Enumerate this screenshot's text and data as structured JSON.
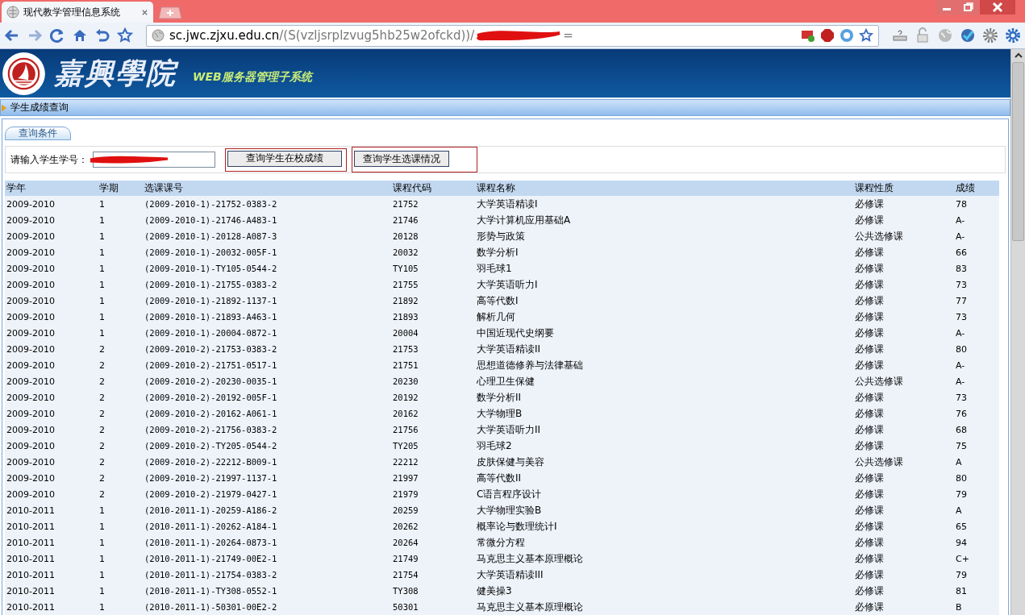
{
  "browser": {
    "tab_title": "现代教学管理信息系统",
    "url_host": "sc.jwc.zjxu.edu.cn",
    "url_path": "/(S(vzljsrplzvug5hb25w2ofckd))/",
    "url_tail": "="
  },
  "header": {
    "logo_text": "嘉興學院",
    "subtitle": "WEB服务器管理子系统"
  },
  "panel": {
    "title": "学生成绩查询",
    "tab": "查询条件"
  },
  "form": {
    "label": "请输入学生学号：",
    "buttons": [
      "查询学生在校成绩",
      "查询学生选课情况"
    ]
  },
  "table": {
    "columns": [
      "学年",
      "学期",
      "选课课号",
      "课程代码",
      "课程名称",
      "课程性质",
      "成绩"
    ],
    "rows": [
      [
        "2009-2010",
        "1",
        "(2009-2010-1)-21752-0383-2",
        "21752",
        "大学英语精读I",
        "必修课",
        "78"
      ],
      [
        "2009-2010",
        "1",
        "(2009-2010-1)-21746-A483-1",
        "21746",
        "大学计算机应用基础A",
        "必修课",
        "A-"
      ],
      [
        "2009-2010",
        "1",
        "(2009-2010-1)-20128-A087-3",
        "20128",
        "形势与政策",
        "公共选修课",
        "A-"
      ],
      [
        "2009-2010",
        "1",
        "(2009-2010-1)-20032-005F-1",
        "20032",
        "数学分析I",
        "必修课",
        "66"
      ],
      [
        "2009-2010",
        "1",
        "(2009-2010-1)-TY105-0544-2",
        "TY105",
        "羽毛球1",
        "必修课",
        "83"
      ],
      [
        "2009-2010",
        "1",
        "(2009-2010-1)-21755-0383-2",
        "21755",
        "大学英语听力I",
        "必修课",
        "73"
      ],
      [
        "2009-2010",
        "1",
        "(2009-2010-1)-21892-1137-1",
        "21892",
        "高等代数I",
        "必修课",
        "77"
      ],
      [
        "2009-2010",
        "1",
        "(2009-2010-1)-21893-A463-1",
        "21893",
        "解析几何",
        "必修课",
        "73"
      ],
      [
        "2009-2010",
        "1",
        "(2009-2010-1)-20004-0872-1",
        "20004",
        "中国近现代史纲要",
        "必修课",
        "A-"
      ],
      [
        "2009-2010",
        "2",
        "(2009-2010-2)-21753-0383-2",
        "21753",
        "大学英语精读II",
        "必修课",
        "80"
      ],
      [
        "2009-2010",
        "2",
        "(2009-2010-2)-21751-0517-1",
        "21751",
        "思想道德修养与法律基础",
        "必修课",
        "A-"
      ],
      [
        "2009-2010",
        "2",
        "(2009-2010-2)-20230-0035-1",
        "20230",
        "心理卫生保健",
        "公共选修课",
        "A-"
      ],
      [
        "2009-2010",
        "2",
        "(2009-2010-2)-20192-005F-1",
        "20192",
        "数学分析II",
        "必修课",
        "73"
      ],
      [
        "2009-2010",
        "2",
        "(2009-2010-2)-20162-A061-1",
        "20162",
        "大学物理B",
        "必修课",
        "76"
      ],
      [
        "2009-2010",
        "2",
        "(2009-2010-2)-21756-0383-2",
        "21756",
        "大学英语听力II",
        "必修课",
        "68"
      ],
      [
        "2009-2010",
        "2",
        "(2009-2010-2)-TY205-0544-2",
        "TY205",
        "羽毛球2",
        "必修课",
        "75"
      ],
      [
        "2009-2010",
        "2",
        "(2009-2010-2)-22212-B009-1",
        "22212",
        "皮肤保健与美容",
        "公共选修课",
        "A"
      ],
      [
        "2009-2010",
        "2",
        "(2009-2010-2)-21997-1137-1",
        "21997",
        "高等代数II",
        "必修课",
        "80"
      ],
      [
        "2009-2010",
        "2",
        "(2009-2010-2)-21979-0427-1",
        "21979",
        "C语言程序设计",
        "必修课",
        "79"
      ],
      [
        "2010-2011",
        "1",
        "(2010-2011-1)-20259-A186-2",
        "20259",
        "大学物理实验B",
        "必修课",
        "A"
      ],
      [
        "2010-2011",
        "1",
        "(2010-2011-1)-20262-A184-1",
        "20262",
        "概率论与数理统计I",
        "必修课",
        "65"
      ],
      [
        "2010-2011",
        "1",
        "(2010-2011-1)-20264-0873-1",
        "20264",
        "常微分方程",
        "必修课",
        "94"
      ],
      [
        "2010-2011",
        "1",
        "(2010-2011-1)-21749-00E2-1",
        "21749",
        "马克思主义基本原理概论",
        "必修课",
        "C+"
      ],
      [
        "2010-2011",
        "1",
        "(2010-2011-1)-21754-0383-2",
        "21754",
        "大学英语精读III",
        "必修课",
        "79"
      ],
      [
        "2010-2011",
        "1",
        "(2010-2011-1)-TY308-0552-1",
        "TY308",
        "健美操3",
        "必修课",
        "81"
      ],
      [
        "2010-2011",
        "1",
        "(2010-2011-1)-50301-00E2-2",
        "50301",
        "马克思主义基本原理概论",
        "必修课",
        "B"
      ]
    ]
  }
}
